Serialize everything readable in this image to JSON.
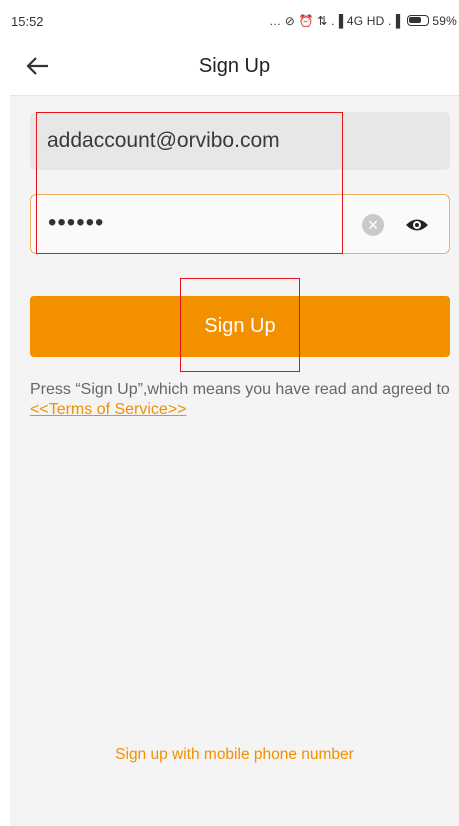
{
  "status_bar": {
    "time": "15:52",
    "indicators": "… ⊘ ⏰ ⇅ .▐ 4G HD .▐",
    "battery": "59%"
  },
  "app_bar": {
    "back_icon": "arrow-left-icon",
    "title": "Sign Up"
  },
  "form": {
    "email_value": "addaccount@orvibo.com",
    "password_value": "••••••",
    "clear_icon": "clear-icon",
    "visibility_icon": "eye-icon",
    "submit_label": "Sign Up"
  },
  "terms": {
    "prefix": "Press “Sign Up”,which means you have read and agreed to",
    "link_text": "<<Terms of Service>>"
  },
  "alternate": {
    "link_text": "Sign up with mobile phone number"
  },
  "colors": {
    "accent": "#f29000",
    "annotation": "#e5141b",
    "background": "#f4f4f4"
  }
}
